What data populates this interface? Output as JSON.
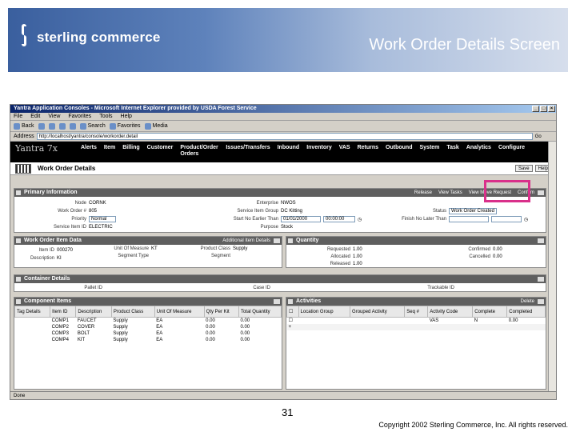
{
  "slide": {
    "logo_text": "sterling commerce",
    "title": "Work Order Details Screen",
    "page_number": "31",
    "copyright": "Copyright 2002 Sterling Commerce, Inc. All rights reserved.",
    "highlight_color": "#d9308a"
  },
  "browser": {
    "title": "Yantra Application Consoles - Microsoft Internet Explorer provided by USDA Forest Service",
    "menu": [
      "File",
      "Edit",
      "View",
      "Favorites",
      "Tools",
      "Help"
    ],
    "toolbar": [
      "Back",
      "Search",
      "Favorites",
      "Media"
    ],
    "address_label": "Address",
    "address_value": "http://localhost/yantra/console/workorder.detail",
    "go_label": "Go",
    "status_text": "Done"
  },
  "app": {
    "brand": "Yantra 7x",
    "nav": [
      "Alerts",
      "Item",
      "Billing",
      "Customer",
      "Product/Order Orders",
      "Issues/Transfers",
      "Inbound",
      "Inventory",
      "VAS",
      "Returns",
      "Outbound",
      "System",
      "Task",
      "Analytics",
      "Configure"
    ],
    "page_title": "Work Order Details",
    "save_label": "Save",
    "help_label": "Help"
  },
  "primary": {
    "title": "Primary Information",
    "actions": [
      "Release",
      "View Tasks",
      "View Move Request",
      "Confirm"
    ],
    "fields_col1": [
      {
        "label": "Node",
        "value": "CORNK"
      },
      {
        "label": "Work Order #",
        "value": "805"
      },
      {
        "label": "Priority",
        "value": "Normal"
      },
      {
        "label": "Service Item ID",
        "value": "ELECTRIC"
      }
    ],
    "fields_col2": [
      {
        "label": "Enterprise",
        "value": "NWOS"
      },
      {
        "label": "Service Item Group",
        "value": "DC Kitting"
      },
      {
        "label": "Start No Earlier Than",
        "value": "01/01/2000"
      },
      {
        "label": "Purpose",
        "value": "Stock"
      }
    ],
    "start_time": "00:00:00",
    "status_label": "Status",
    "status_value": "Work Order Created",
    "finish_label": "Finish No Later Than"
  },
  "item_data": {
    "title": "Work Order Item Data",
    "actions": [
      "Additional Item Details"
    ],
    "fields": [
      {
        "label": "Item ID",
        "value": "000270"
      },
      {
        "label": "Description",
        "value": "KI"
      },
      {
        "label": "Unit Of Measure",
        "value": "KT"
      },
      {
        "label": "Product Class",
        "value": "Supply"
      },
      {
        "label": "Segment Type",
        "value": ""
      },
      {
        "label": "Segment",
        "value": ""
      }
    ]
  },
  "quantity": {
    "title": "Quantity",
    "rows": [
      {
        "label": "Requested",
        "value": "1.00",
        "label2": "Confirmed",
        "value2": "0.00"
      },
      {
        "label": "Allocated",
        "value": "1.00",
        "label2": "Cancelled",
        "value2": "0.00"
      },
      {
        "label": "Released",
        "value": "1.00",
        "label2": "",
        "value2": ""
      }
    ]
  },
  "container": {
    "title": "Container Details",
    "fields": [
      {
        "label": "Pallet ID",
        "value": ""
      },
      {
        "label": "Case ID",
        "value": ""
      },
      {
        "label": "Trackable ID",
        "value": ""
      }
    ]
  },
  "components": {
    "title": "Component Items",
    "columns": [
      "Tag Details",
      "Item ID",
      "Description",
      "Product Class",
      "Unit Of Measure",
      "Qty Per Kit",
      "Total Quantity"
    ],
    "rows": [
      [
        "",
        "COMP1",
        "FAUCET",
        "Supply",
        "EA",
        "0.00",
        "0.00"
      ],
      [
        "",
        "COMP2",
        "COVER",
        "Supply",
        "EA",
        "0.00",
        "0.00"
      ],
      [
        "",
        "COMP3",
        "BOLT",
        "Supply",
        "EA",
        "0.00",
        "0.00"
      ],
      [
        "",
        "COMP4",
        "KIT",
        "Supply",
        "EA",
        "0.00",
        "0.00"
      ]
    ]
  },
  "activities": {
    "title": "Activities",
    "actions": [
      "Delete"
    ],
    "columns": [
      "Location Group",
      "Grouped Activity",
      "Seq #",
      "Activity Code",
      "Complete",
      "Completed"
    ],
    "rows": [
      [
        "",
        "",
        "",
        "VAS",
        "N",
        "0.00"
      ]
    ]
  }
}
